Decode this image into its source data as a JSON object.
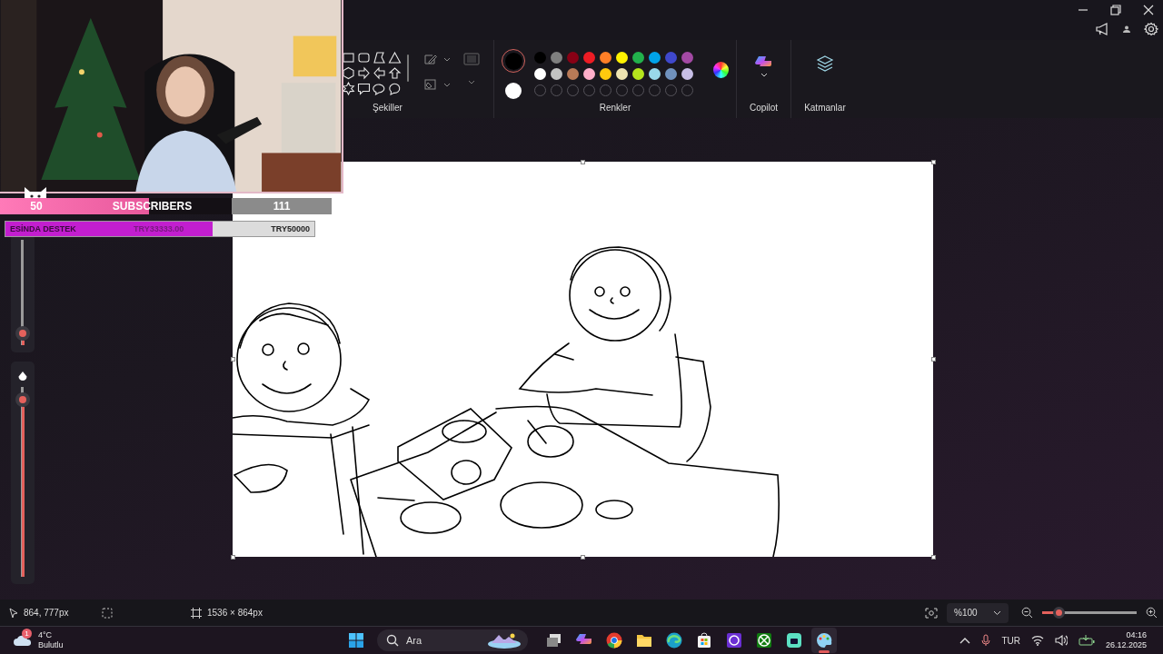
{
  "stream_overlay": {
    "subscribers": {
      "current": "50",
      "label": "SUBSCRIBERS",
      "goal": "111",
      "level": 0.45
    },
    "donation_goal": {
      "label": "ESİNDA DESTEK",
      "current": "TRY33333.00",
      "goal": "TRY50000",
      "level": 0.67
    }
  },
  "toolbar": {
    "shapes": {
      "label": "Şekiller"
    },
    "colors": {
      "label": "Renkler",
      "current": [
        {
          "kind": "primary",
          "selected": true,
          "color": "#000000"
        },
        {
          "kind": "secondary",
          "selected": false,
          "color": "#ffffff"
        }
      ],
      "palette": [
        {
          "kind": "swatch",
          "color": "#000000"
        },
        {
          "kind": "swatch",
          "color": "#7f7f7f"
        },
        {
          "kind": "swatch",
          "color": "#880015"
        },
        {
          "kind": "swatch",
          "color": "#ed1c24"
        },
        {
          "kind": "swatch",
          "color": "#ff7f27"
        },
        {
          "kind": "swatch",
          "color": "#fff200"
        },
        {
          "kind": "swatch",
          "color": "#22b14c"
        },
        {
          "kind": "swatch",
          "color": "#00a2e8"
        },
        {
          "kind": "swatch",
          "color": "#3f48cc"
        },
        {
          "kind": "swatch",
          "color": "#a349a4"
        },
        {
          "kind": "swatch",
          "color": "#ffffff"
        },
        {
          "kind": "swatch",
          "color": "#c3c3c3"
        },
        {
          "kind": "swatch",
          "color": "#b97a57"
        },
        {
          "kind": "swatch",
          "color": "#ffaec9"
        },
        {
          "kind": "swatch",
          "color": "#ffc90e"
        },
        {
          "kind": "swatch",
          "color": "#efe4b0"
        },
        {
          "kind": "swatch",
          "color": "#b5e61d"
        },
        {
          "kind": "swatch",
          "color": "#99d9ea"
        },
        {
          "kind": "swatch",
          "color": "#7092be"
        },
        {
          "kind": "swatch",
          "color": "#c8bfe7"
        },
        {
          "kind": "empty"
        },
        {
          "kind": "empty"
        },
        {
          "kind": "empty"
        },
        {
          "kind": "empty"
        },
        {
          "kind": "empty"
        },
        {
          "kind": "empty"
        },
        {
          "kind": "empty"
        },
        {
          "kind": "empty"
        },
        {
          "kind": "empty"
        },
        {
          "kind": "empty"
        }
      ]
    },
    "copilot": {
      "label": "Copilot"
    },
    "layers": {
      "label": "Katmanlar"
    }
  },
  "side_sliders": [
    {
      "kind": "size",
      "level": 0.05
    },
    {
      "kind": "opacity",
      "level": 0.97
    }
  ],
  "status_bar": {
    "cursor": "864, 777px",
    "canvas_size": "1536 × 864px",
    "zoom": "%100",
    "zoom_slider": {
      "level": 0.13
    }
  },
  "taskbar": {
    "weather": {
      "badge": "1",
      "temperature": "4°C",
      "condition": "Bulutlu"
    },
    "search": {
      "placeholder": "Ara"
    },
    "apps": [
      {
        "kind": "start",
        "selected": false
      },
      {
        "kind": "search",
        "selected": false
      },
      {
        "kind": "taskview",
        "selected": false
      },
      {
        "kind": "copilot",
        "selected": false
      },
      {
        "kind": "chrome",
        "selected": false
      },
      {
        "kind": "folder",
        "selected": false
      },
      {
        "kind": "edge",
        "selected": false
      },
      {
        "kind": "store",
        "selected": false
      },
      {
        "kind": "purple",
        "selected": false
      },
      {
        "kind": "xbox",
        "selected": false
      },
      {
        "kind": "teal",
        "selected": false
      },
      {
        "kind": "paint",
        "selected": true
      }
    ],
    "tray": {
      "language": "TUR",
      "time": "04:16",
      "date": "26.12.2025"
    }
  }
}
